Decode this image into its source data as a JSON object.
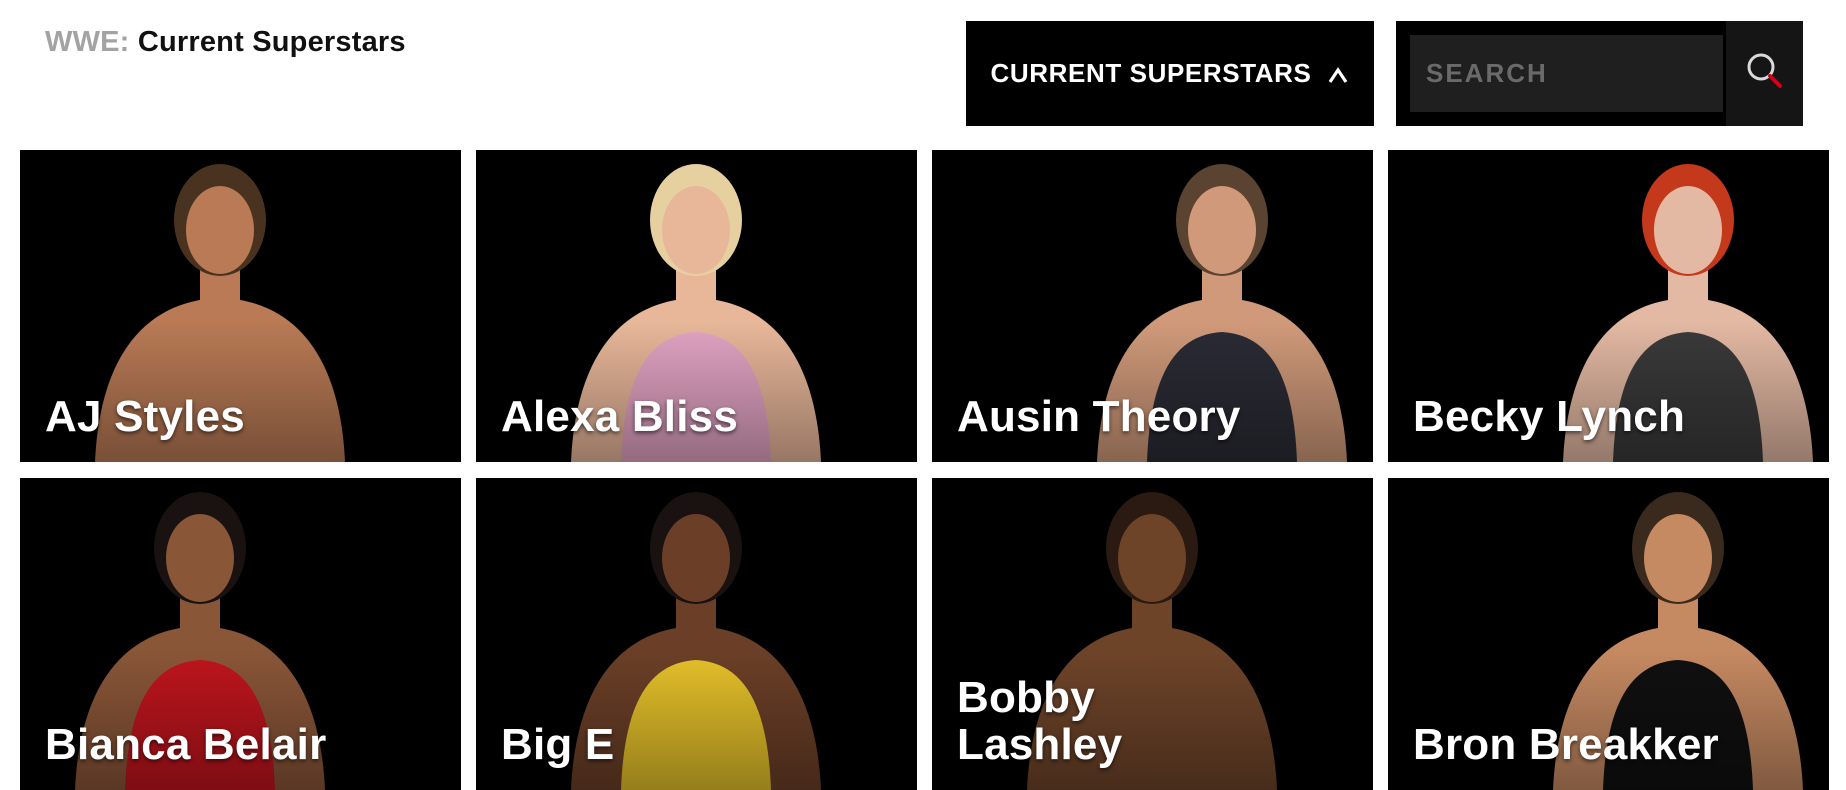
{
  "header": {
    "breadcrumb_brand": "WWE:",
    "breadcrumb_title": "Current Superstars"
  },
  "filter": {
    "selected": "CURRENT SUPERSTARS",
    "icon": "chevron-up-icon"
  },
  "search": {
    "placeholder": "SEARCH",
    "value": "",
    "icon": "search-icon"
  },
  "colors": {
    "card_bg": "#000000",
    "accent_red": "#d0021b",
    "brand_gray": "#a3a3a3"
  },
  "superstars": [
    {
      "name": "AJ Styles",
      "skin": "#b97a55",
      "hair": "#4a3220",
      "outfit": "none"
    },
    {
      "name": "Alexa Bliss",
      "skin": "#e8b79a",
      "hair": "#e6d0a0",
      "outfit": "#e3a4c4"
    },
    {
      "name": "Ausin Theory",
      "skin": "#d09a7a",
      "hair": "#5a4330",
      "outfit": "#2b2b35"
    },
    {
      "name": "Becky Lynch",
      "skin": "#e3b9a3",
      "hair": "#c4391c",
      "outfit": "#3a3a3a"
    },
    {
      "name": "Bianca Belair",
      "skin": "#8a5638",
      "hair": "#1a1210",
      "outfit": "#c0151d"
    },
    {
      "name": "Big E",
      "skin": "#6b3f27",
      "hair": "#1a1210",
      "outfit": "#e6c22a"
    },
    {
      "name": "Bobby\nLashley",
      "skin": "#6e4429",
      "hair": "#2a1a12",
      "outfit": "none"
    },
    {
      "name": "Bron Breakker",
      "skin": "#c68a62",
      "hair": "#3a2a1e",
      "outfit": "#101010"
    }
  ]
}
